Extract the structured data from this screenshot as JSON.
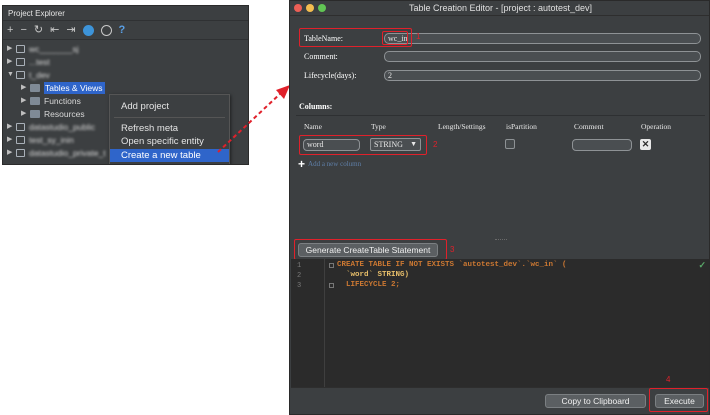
{
  "project_explorer": {
    "title": "Project Explorer",
    "toolbar_icons": [
      "plus-icon",
      "minus-icon",
      "refresh-icon",
      "collapse-icon",
      "expand-icon",
      "cloud-icon",
      "info-icon",
      "help-icon"
    ],
    "toolbar_glyphs": {
      "plus": "+",
      "minus": "−",
      "refresh": "↻",
      "collapse": "⇤",
      "expand": "⇥",
      "help": "?"
    },
    "tree": [
      {
        "label": "wc_______sj",
        "blurred": true
      },
      {
        "label": "...test",
        "blurred": true
      },
      {
        "label": "t_dev",
        "blurred": true
      },
      {
        "label": "Tables & Views",
        "selected": true
      },
      {
        "label": "Functions"
      },
      {
        "label": "Resources"
      },
      {
        "label": "datastudio_public",
        "blurred": true
      },
      {
        "label": "test_sy_inin",
        "blurred": true
      },
      {
        "label": "datastudio_private_t",
        "blurred": true
      }
    ],
    "context_menu": {
      "add_project": "Add project",
      "refresh_meta": "Refresh meta",
      "open_specific_entity": "Open specific entity",
      "create_new_table": "Create a new table"
    }
  },
  "editor": {
    "title": "Table Creation Editor - [project : autotest_dev]",
    "table_name_label": "TableName:",
    "table_name_value": "wc_in",
    "comment_label": "Comment:",
    "comment_value": "",
    "lifecycle_label": "Lifecycle(days):",
    "lifecycle_value": "2",
    "columns_label": "Columns:",
    "column_headers": [
      "Name",
      "Type",
      "Length/Settings",
      "isPartition",
      "Comment",
      "Operation"
    ],
    "column_row": {
      "name": "word",
      "type": "STRING",
      "comment": ""
    },
    "add_column_label": "Add a new column",
    "generate_button": "Generate CreateTable Statement",
    "code_lines": [
      {
        "num": "1",
        "text": "CREATE TABLE IF NOT EXISTS `autotest_dev`.`wc_in` ("
      },
      {
        "num": "2",
        "text": "  `word` STRING)"
      },
      {
        "num": "3",
        "text": "  LIFECYCLE 2;"
      }
    ],
    "copy_button": "Copy to Clipboard",
    "execute_button": "Execute",
    "annotation_numbers": [
      "1",
      "2",
      "3",
      "4"
    ],
    "colors": {
      "highlight_box": "#e0212b",
      "selection": "#2f65ca",
      "keyword": "#cc7832",
      "string": "#e8bf6a"
    }
  }
}
